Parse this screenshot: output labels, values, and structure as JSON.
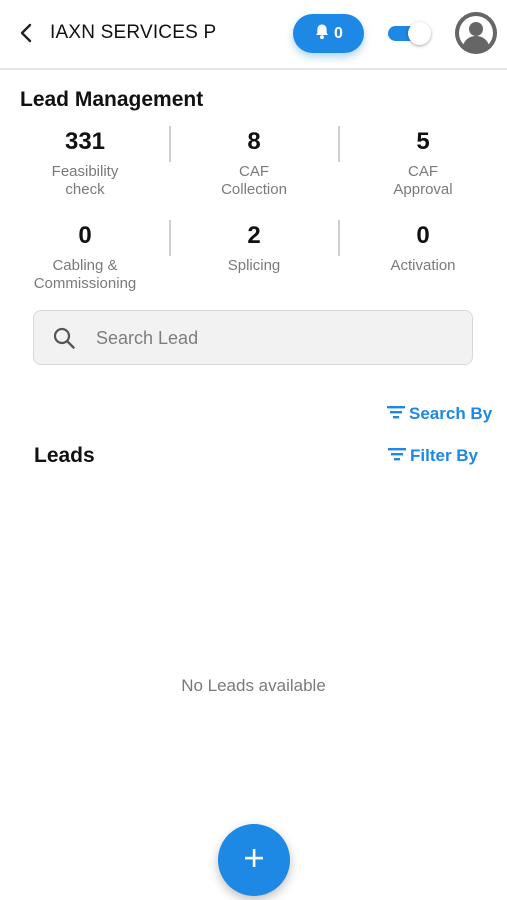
{
  "header": {
    "title": "IAXN SERVICES P",
    "notification_count": "0",
    "toggle_on": true
  },
  "lead_management": {
    "title": "Lead Management",
    "stats": [
      {
        "value": "331",
        "label": "Feasibility\ncheck"
      },
      {
        "value": "8",
        "label": "CAF\nCollection"
      },
      {
        "value": "5",
        "label": "CAF\nApproval"
      },
      {
        "value": "0",
        "label": "Cabling &\nCommissioning"
      },
      {
        "value": "2",
        "label": "Splicing"
      },
      {
        "value": "0",
        "label": "Activation"
      }
    ]
  },
  "search": {
    "placeholder": "Search Lead"
  },
  "actions": {
    "search_by": "Search By",
    "filter_by": "Filter By"
  },
  "leads": {
    "title": "Leads",
    "empty_message": "No Leads available"
  },
  "colors": {
    "accent": "#1e88e5",
    "muted_text": "#7a7a7a"
  },
  "icons": {
    "back": "chevron-left-icon",
    "bell": "bell-icon",
    "avatar": "user-avatar-icon",
    "search": "search-icon",
    "sort": "sort-lines-icon",
    "add": "plus-icon"
  }
}
